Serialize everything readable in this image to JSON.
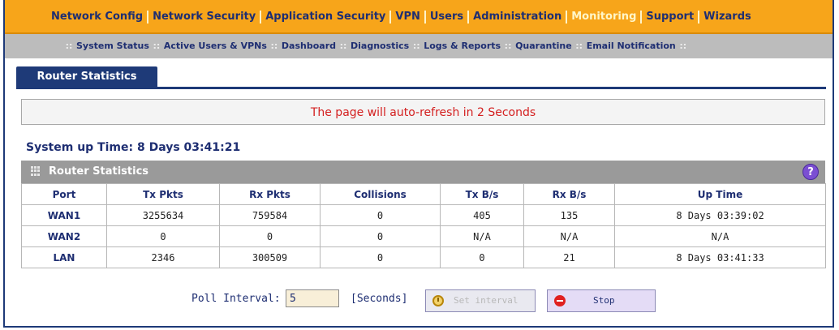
{
  "nav": {
    "items": [
      {
        "label": "Network Config"
      },
      {
        "label": "Network Security"
      },
      {
        "label": "Application Security"
      },
      {
        "label": "VPN"
      },
      {
        "label": "Users"
      },
      {
        "label": "Administration"
      },
      {
        "label": "Monitoring",
        "active": true
      },
      {
        "label": "Support"
      },
      {
        "label": "Wizards"
      }
    ]
  },
  "subnav": {
    "items": [
      {
        "label": "System Status"
      },
      {
        "label": "Active Users & VPNs"
      },
      {
        "label": "Dashboard"
      },
      {
        "label": "Diagnostics"
      },
      {
        "label": "Logs & Reports"
      },
      {
        "label": "Quarantine"
      },
      {
        "label": "Email Notification"
      }
    ]
  },
  "tab": {
    "label": "Router Statistics"
  },
  "refresh_message": "The page will auto-refresh in 2 Seconds",
  "uptime": "System up Time: 8 Days 03:41:21",
  "table": {
    "title": "Router Statistics",
    "help_symbol": "?",
    "columns": [
      "Port",
      "Tx Pkts",
      "Rx Pkts",
      "Collisions",
      "Tx B/s",
      "Rx B/s",
      "Up Time"
    ],
    "rows": [
      [
        "WAN1",
        "3255634",
        "759584",
        "0",
        "405",
        "135",
        "8 Days 03:39:02"
      ],
      [
        "WAN2",
        "0",
        "0",
        "0",
        "N/A",
        "N/A",
        "N/A"
      ],
      [
        "LAN",
        "2346",
        "300509",
        "0",
        "0",
        "21",
        "8 Days 03:41:33"
      ]
    ]
  },
  "poll": {
    "label": "Poll Interval:",
    "value": "5",
    "unit": "[Seconds]",
    "set_button": "Set interval",
    "stop_button": "Stop"
  },
  "colors": {
    "nav_bg": "#f7a51a",
    "nav_text": "#1e2e72",
    "tab_bg": "#1e3a78",
    "refresh_text": "#d42020"
  }
}
